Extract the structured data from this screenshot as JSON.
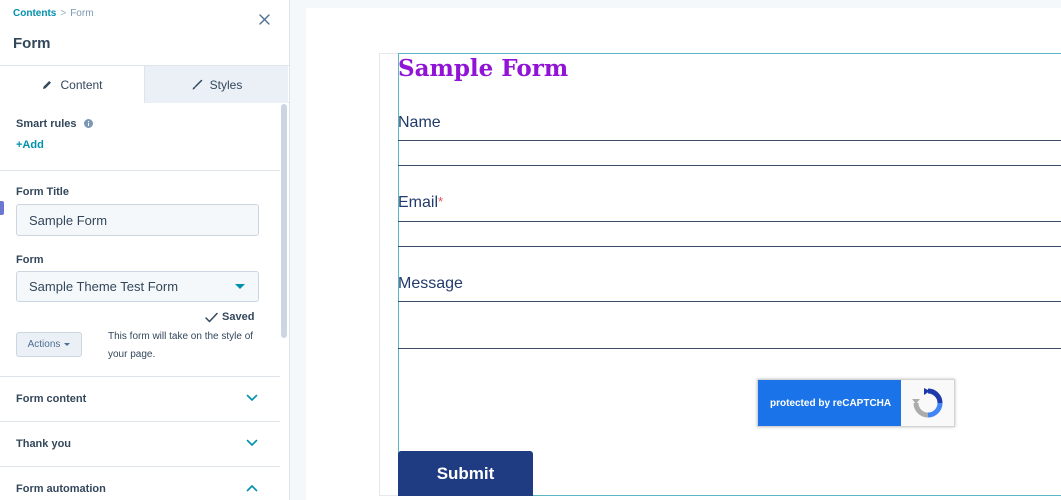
{
  "breadcrumb": {
    "root": "Contents",
    "separator": ">",
    "current": "Form"
  },
  "panel": {
    "title": "Form"
  },
  "tabs": [
    {
      "label": "Content",
      "icon": "pencil-icon",
      "active": true
    },
    {
      "label": "Styles",
      "icon": "brush-icon",
      "active": false
    }
  ],
  "smart_rules": {
    "label": "Smart rules",
    "add_label": "+Add"
  },
  "form_title": {
    "label": "Form Title",
    "value": "Sample Form"
  },
  "form_select": {
    "label": "Form",
    "value": "Sample Theme Test Form"
  },
  "status": {
    "saved": "Saved"
  },
  "actions": {
    "label": "Actions",
    "help": "This form will take on the style of your page."
  },
  "accordions": [
    {
      "label": "Form content",
      "expanded": false
    },
    {
      "label": "Thank you",
      "expanded": false
    },
    {
      "label": "Form automation",
      "expanded": true
    }
  ],
  "preview": {
    "title": "Sample Form",
    "fields": [
      {
        "label": "Name",
        "required": false
      },
      {
        "label": "Email",
        "required": true,
        "required_mark": "*"
      },
      {
        "label": "Message",
        "required": false
      }
    ],
    "recaptcha_text": "protected by reCAPTCHA",
    "submit_label": "Submit"
  },
  "colors": {
    "accent": "#0091ae",
    "form_title": "#9013d6",
    "submit_bg": "#1f3b82",
    "recaptcha_blue": "#1a73e8"
  }
}
